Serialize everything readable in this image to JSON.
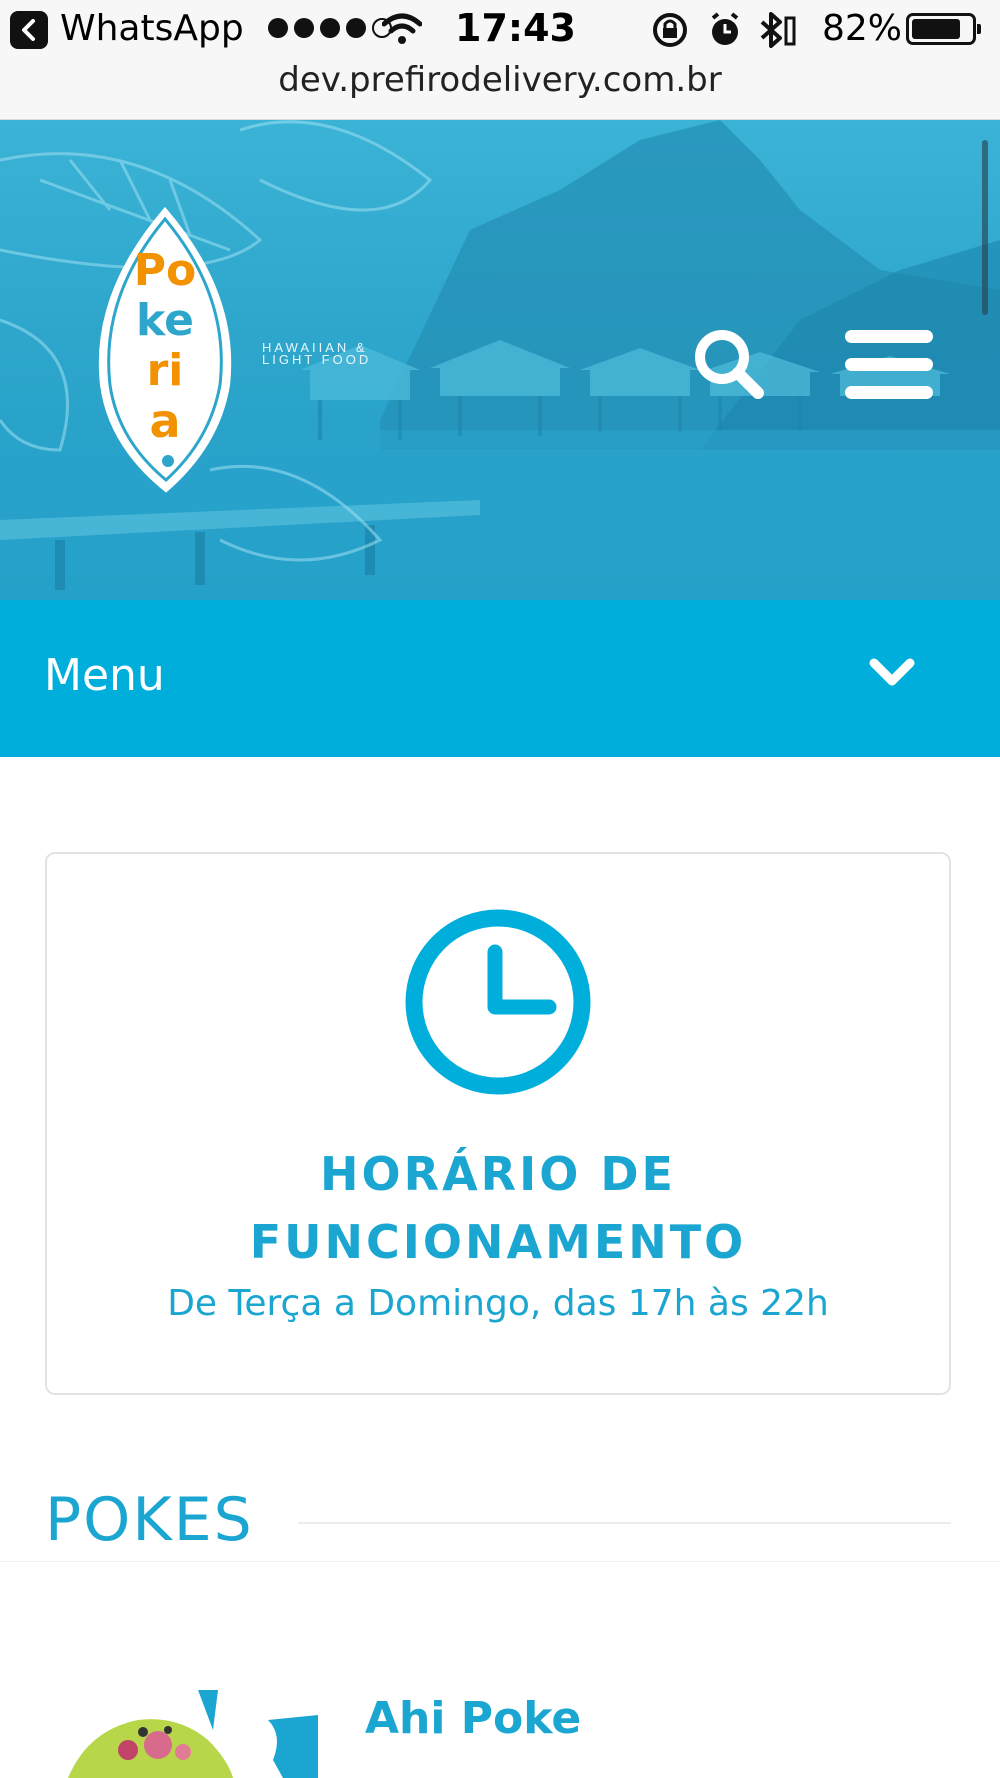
{
  "status_bar": {
    "back_app": "WhatsApp",
    "time": "17:43",
    "battery_percent": "82%",
    "battery_level": 0.82,
    "signal_filled": 4,
    "signal_total": 5,
    "icons": [
      "wifi-icon",
      "orientation-lock-icon",
      "alarm-icon",
      "bluetooth-icon"
    ]
  },
  "browser": {
    "url": "dev.prefirodelivery.com.br"
  },
  "hero": {
    "brand_tagline": "HAWAIIAN & LIGHT FOOD",
    "icons": [
      "search-icon",
      "hamburger-menu-icon"
    ]
  },
  "menu_bar": {
    "label": "Menu",
    "icon": "chevron-down-icon"
  },
  "hours_card": {
    "icon": "clock-icon",
    "title_line1": "HORÁRIO DE",
    "title_line2": "FUNCIONAMENTO",
    "text": "De Terça a Domingo, das 17h às 22h"
  },
  "section": {
    "title": "POKES"
  },
  "products": [
    {
      "name": "Ahi Poke"
    }
  ],
  "colors": {
    "accent": "#00aedc",
    "text_accent": "#1ba6d2",
    "logo_orange": "#f39200"
  }
}
